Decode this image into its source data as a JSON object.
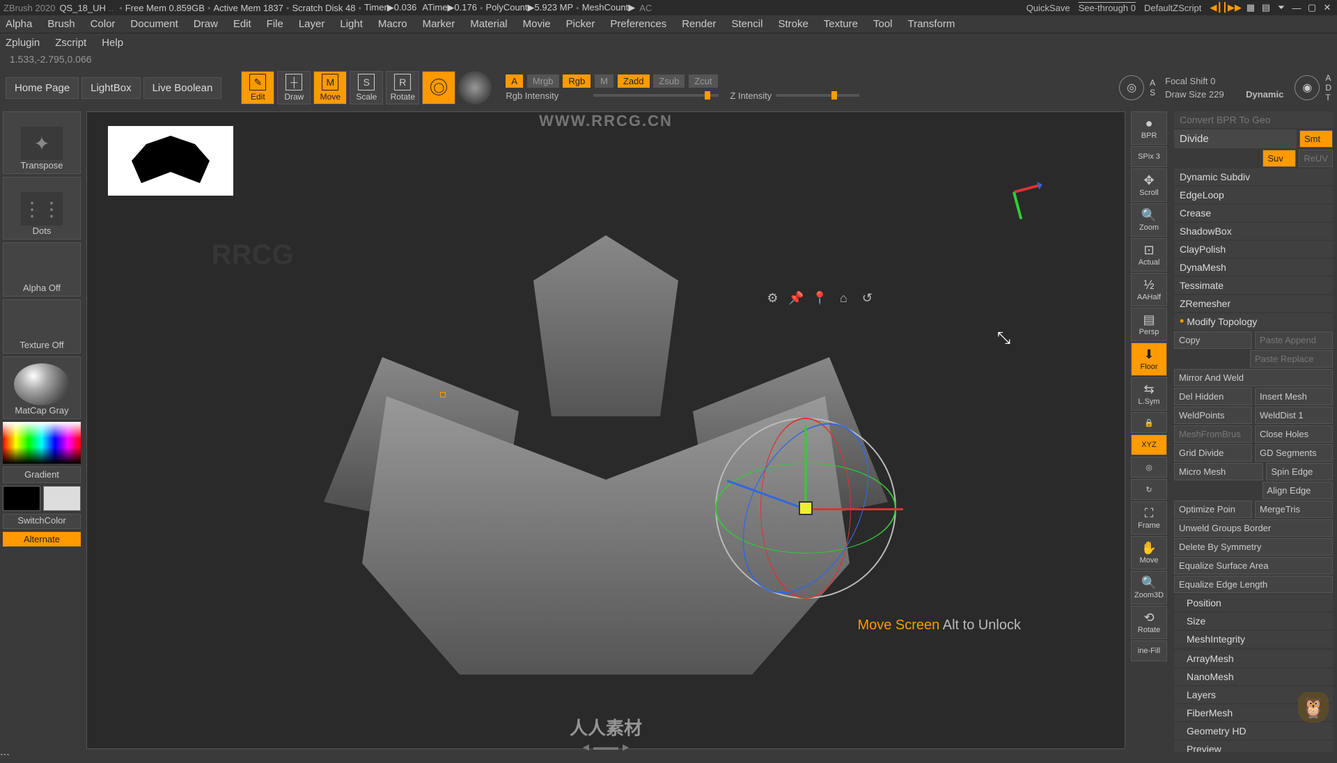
{
  "titlebar": {
    "app": "ZBrush 2020",
    "project": "QS_18_UH",
    "stats": {
      "free_mem": "Free Mem 0.859GB",
      "active_mem": "Active Mem 1837",
      "scratch": "Scratch Disk 48",
      "timer": "Timer▶0.036",
      "atime": "ATime▶0.176",
      "polycount": "PolyCount▶5.923 MP",
      "meshcount": "MeshCount▶",
      "ac": "AC"
    },
    "quicksave": "QuickSave",
    "seethrough": "See-through  0",
    "script": "DefaultZScript"
  },
  "menus1": [
    "Alpha",
    "Brush",
    "Color",
    "Document",
    "Draw",
    "Edit",
    "File",
    "Layer",
    "Light",
    "Macro",
    "Marker",
    "Material",
    "Movie",
    "Picker",
    "Preferences",
    "Render",
    "Stencil",
    "Stroke",
    "Texture",
    "Tool",
    "Transform"
  ],
  "menus2": [
    "Zplugin",
    "Zscript",
    "Help"
  ],
  "coords": "1.533,-2.795,0.066",
  "topbuttons": {
    "home": "Home Page",
    "lightbox": "LightBox",
    "liveboolean": "Live Boolean"
  },
  "tools": {
    "edit": "Edit",
    "draw": "Draw",
    "move": "Move",
    "scale": "Scale",
    "rotate": "Rotate"
  },
  "channels": {
    "mrgb": "Mrgb",
    "rgb": "Rgb",
    "m": "M",
    "zadd": "Zadd",
    "zsub": "Zsub",
    "zcut": "Zcut"
  },
  "sliders": {
    "rgb_label": "Rgb Intensity",
    "z_label": "Z Intensity",
    "focal_label": "Focal Shift",
    "focal_val": "0",
    "draw_label": "Draw Size",
    "draw_val": "229",
    "dynamic": "Dynamic",
    "a": "A",
    "s": "S",
    "d": "D",
    "t": "T"
  },
  "left": {
    "transpose": "Transpose",
    "dots": "Dots",
    "alpha": "Alpha Off",
    "texture": "Texture Off",
    "material": "MatCap Gray",
    "gradient": "Gradient",
    "switch": "SwitchColor",
    "alternate": "Alternate"
  },
  "canvas": {
    "hint_orange": "Move Screen",
    "hint_grey": "Alt to Unlock",
    "watermark1": "WWW.RRCG.CN",
    "watermark2": "人人素材",
    "wm_ghost": "RRCG"
  },
  "midright": {
    "bpr": "BPR",
    "spix": "SPix 3",
    "scroll": "Scroll",
    "zoom": "Zoom",
    "actual": "Actual",
    "aahalf": "AAHalf",
    "persp": "Persp",
    "floor": "Floor",
    "lsym": "L.Sym",
    "xyz": "XYZ",
    "frame": "Frame",
    "move": "Move",
    "zoom3d": "Zoom3D",
    "rotate": "Rotate",
    "linefill": "ine-Fill"
  },
  "right": {
    "convert": "Convert BPR To Geo",
    "divide": "Divide",
    "smt": "Smt",
    "suv": "Suv",
    "reuv": "ReUV",
    "items": [
      "Dynamic Subdiv",
      "EdgeLoop",
      "Crease",
      "ShadowBox",
      "ClayPolish",
      "DynaMesh",
      "Tessimate",
      "ZRemesher"
    ],
    "modify": "Modify Topology",
    "copy": "Copy",
    "paste_append": "Paste Append",
    "paste_replace": "Paste Replace",
    "mirror": "Mirror And Weld",
    "del_hidden": "Del Hidden",
    "insert_mesh": "Insert Mesh",
    "weldpoints": "WeldPoints",
    "welddist": "WeldDist 1",
    "meshfrombrush": "MeshFromBrus",
    "close_holes": "Close Holes",
    "grid_divide": "Grid Divide",
    "gd_segments": "GD Segments",
    "micro_mesh": "Micro Mesh",
    "spin_edge": "Spin Edge",
    "align_edge": "Align Edge",
    "optimize": "Optimize Poin",
    "mergetris": "MergeTris",
    "unweld": "Unweld Groups Border",
    "del_sym": "Delete By Symmetry",
    "eq_surface": "Equalize Surface Area",
    "eq_edge": "Equalize Edge Length",
    "position": "Position",
    "size": "Size",
    "meshintegrity": "MeshIntegrity",
    "arraymesh": "ArrayMesh",
    "nanomesh": "NanoMesh",
    "layers": "Layers",
    "fibermesh": "FiberMesh",
    "geomhd": "Geometry HD",
    "preview": "Preview"
  }
}
